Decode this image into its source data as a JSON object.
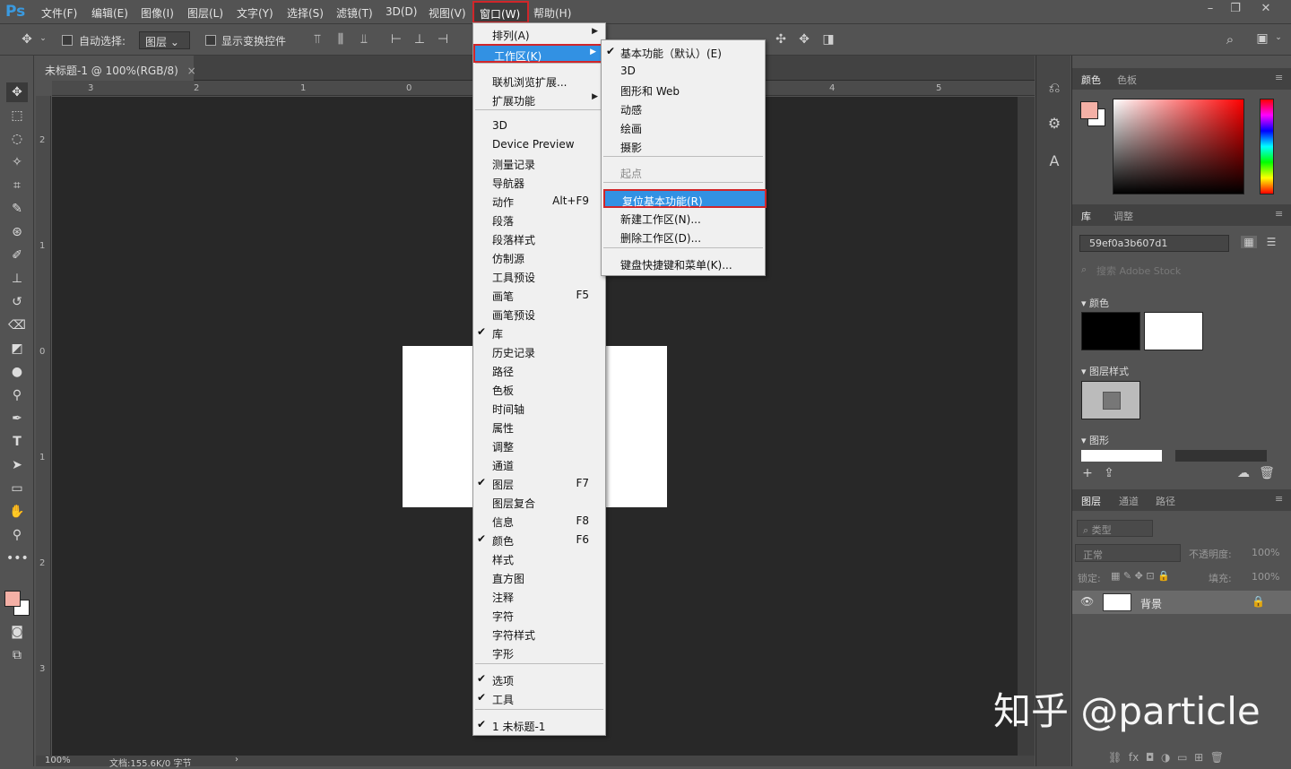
{
  "app": {
    "logo": "Ps"
  },
  "menubar": {
    "items": [
      "文件(F)",
      "编辑(E)",
      "图像(I)",
      "图层(L)",
      "文字(Y)",
      "选择(S)",
      "滤镜(T)",
      "3D(D)",
      "视图(V)",
      "窗口(W)",
      "帮助(H)"
    ],
    "active": "窗口(W)"
  },
  "options_bar": {
    "auto_select_label": "自动选择:",
    "auto_select_value": "图层",
    "show_transform_label": "显示变换控件"
  },
  "document": {
    "tab_title": "未标题-1 @ 100%(RGB/8)",
    "zoom": "100%",
    "doc_info": "文档:155.6K/0 字节"
  },
  "ruler": {
    "top": [
      "3",
      "2",
      "1",
      "0",
      "4",
      "5"
    ],
    "left": [
      "2",
      "1",
      "0",
      "1",
      "2",
      "3"
    ]
  },
  "window_menu": {
    "items": [
      {
        "label": "排列(A)",
        "submenu": true
      },
      {
        "label": "工作区(K)",
        "submenu": true,
        "highlight": true
      },
      {
        "label": "联机浏览扩展..."
      },
      {
        "label": "扩展功能",
        "submenu": true
      },
      {
        "label": "3D"
      },
      {
        "label": "Device Preview"
      },
      {
        "label": "测量记录"
      },
      {
        "label": "导航器"
      },
      {
        "label": "动作",
        "shortcut": "Alt+F9"
      },
      {
        "label": "段落"
      },
      {
        "label": "段落样式"
      },
      {
        "label": "仿制源"
      },
      {
        "label": "工具预设"
      },
      {
        "label": "画笔",
        "shortcut": "F5"
      },
      {
        "label": "画笔预设"
      },
      {
        "label": "库",
        "checked": true
      },
      {
        "label": "历史记录"
      },
      {
        "label": "路径"
      },
      {
        "label": "色板"
      },
      {
        "label": "时间轴"
      },
      {
        "label": "属性"
      },
      {
        "label": "调整"
      },
      {
        "label": "通道"
      },
      {
        "label": "图层",
        "checked": true,
        "shortcut": "F7"
      },
      {
        "label": "图层复合"
      },
      {
        "label": "信息",
        "shortcut": "F8"
      },
      {
        "label": "颜色",
        "checked": true,
        "shortcut": "F6"
      },
      {
        "label": "样式"
      },
      {
        "label": "直方图"
      },
      {
        "label": "注释"
      },
      {
        "label": "字符"
      },
      {
        "label": "字符样式"
      },
      {
        "label": "字形"
      },
      {
        "label": "选项",
        "checked": true
      },
      {
        "label": "工具",
        "checked": true
      },
      {
        "label": "1 未标题-1",
        "checked": true
      }
    ]
  },
  "workspace_menu": {
    "items": [
      {
        "label": "基本功能（默认）(E)",
        "checked": true
      },
      {
        "label": "3D"
      },
      {
        "label": "图形和 Web"
      },
      {
        "label": "动感"
      },
      {
        "label": "绘画"
      },
      {
        "label": "摄影"
      },
      {
        "label": "起点",
        "disabled": true
      },
      {
        "label": "复位基本功能(R)",
        "highlight": true
      },
      {
        "label": "新建工作区(N)..."
      },
      {
        "label": "删除工作区(D)..."
      },
      {
        "label": "键盘快捷键和菜单(K)..."
      }
    ]
  },
  "panels": {
    "color_tabs": [
      "颜色",
      "色板"
    ],
    "library_tabs": [
      "库",
      "调整"
    ],
    "library_name": "59ef0a3b607d1",
    "search_placeholder": "搜索 Adobe Stock",
    "sections": {
      "colors": "颜色",
      "layer_styles": "图层样式",
      "graphics": "图形"
    },
    "layers_tabs": [
      "图层",
      "通道",
      "路径"
    ],
    "filter_label": "类型",
    "blend_mode": "正常",
    "opacity_label": "不透明度:",
    "opacity_value": "100%",
    "lock_label": "锁定:",
    "fill_label": "填充:",
    "fill_value": "100%",
    "layer_name": "背景"
  },
  "colors": {
    "foreground": "#f4b0a6",
    "background": "#ffffff",
    "accent": "#3291e3",
    "highlight_border": "#d0262a"
  },
  "watermark": "知乎 @particle"
}
